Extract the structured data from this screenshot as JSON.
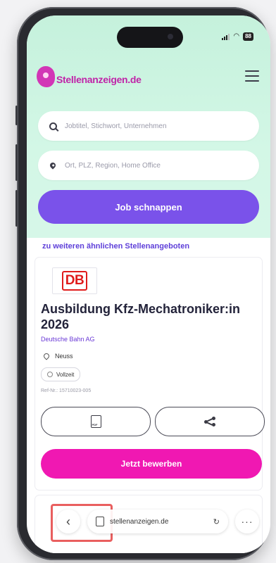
{
  "status_bar": {
    "battery": "88"
  },
  "header": {
    "logo_text": "Stellenanzeigen.de"
  },
  "search": {
    "keyword_placeholder": "Jobtitel, Stichwort, Unternehmen",
    "location_placeholder": "Ort, PLZ, Region, Home Office",
    "submit_label": "Job schnappen"
  },
  "related_link": "zu weiteren ähnlichen Stellenangeboten",
  "job": {
    "company_logo": "DB",
    "title": "Ausbildung Kfz-Mechatroniker:in 2026",
    "company": "Deutsche Bahn AG",
    "location": "Neuss",
    "employment_type": "Vollzeit",
    "reference": "Ref-Nr.: 15710023-005",
    "apply_label": "Jetzt bewerben"
  },
  "browser": {
    "url": "stellenanzeigen.de"
  },
  "icons": [
    "search-icon",
    "location-pin-icon",
    "hamburger-menu-icon",
    "pdf-icon",
    "share-icon",
    "back-icon",
    "page-icon",
    "reload-icon",
    "more-icon"
  ],
  "colors": {
    "hero_bg": "#c5f1dc",
    "violet": "#7a52ea",
    "pink": "#f018b2",
    "db_red": "#e01b1b",
    "brand_magenta": "#c024a8"
  }
}
